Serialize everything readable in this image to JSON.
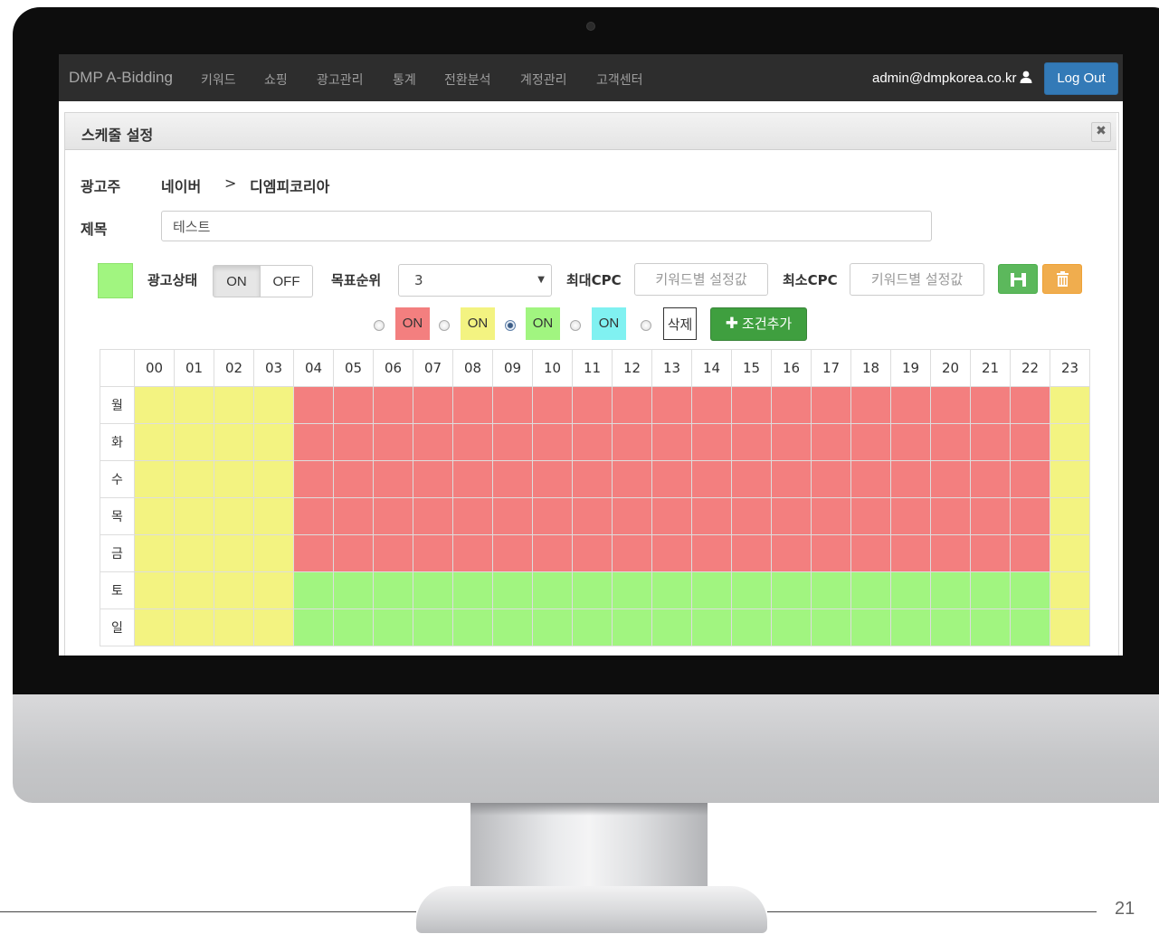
{
  "navbar": {
    "brand": "DMP A-Bidding",
    "items": [
      "키워드",
      "쇼핑",
      "광고관리",
      "통계",
      "전환분석",
      "계정관리",
      "고객센터"
    ],
    "user": "admin@dmpkorea.co.kr",
    "logout_label": "Log Out"
  },
  "modal": {
    "title": "스케줄 설정",
    "close_icon": "close-icon"
  },
  "advertiser": {
    "label": "광고주",
    "platform": "네이버",
    "separator": ">",
    "name": "디엠피코리아"
  },
  "subject": {
    "label": "제목",
    "value": "테스트"
  },
  "controls": {
    "current_color": "#a1f580",
    "status_label": "광고상태",
    "on_label": "ON",
    "off_label": "OFF",
    "status_value": "ON",
    "target_rank_label": "목표순위",
    "target_rank_value": "3",
    "max_cpc_label": "최대CPC",
    "max_cpc_placeholder": "키워드별 설정값",
    "min_cpc_label": "최소CPC",
    "min_cpc_placeholder": "키워드별 설정값",
    "save_icon": "save-icon",
    "delete_icon": "trash-icon"
  },
  "conditions": {
    "items": [
      {
        "label": "ON",
        "color": "#f37f7f",
        "selected": false
      },
      {
        "label": "ON",
        "color": "#f3f381",
        "selected": false
      },
      {
        "label": "ON",
        "color": "#a1f580",
        "selected": true
      },
      {
        "label": "ON",
        "color": "#80f1f1",
        "selected": false
      },
      {
        "label": "삭제",
        "color": "#ffffff",
        "selected": false
      }
    ],
    "add_label": "조건추가"
  },
  "schedule": {
    "hours": [
      "00",
      "01",
      "02",
      "03",
      "04",
      "05",
      "06",
      "07",
      "08",
      "09",
      "10",
      "11",
      "12",
      "13",
      "14",
      "15",
      "16",
      "17",
      "18",
      "19",
      "20",
      "21",
      "22",
      "23"
    ],
    "days": [
      "월",
      "화",
      "수",
      "목",
      "금",
      "토",
      "일"
    ],
    "legend": {
      "1": "red",
      "2": "yellow",
      "3": "green",
      "4": "cyan"
    },
    "grid": [
      [
        2,
        2,
        2,
        2,
        1,
        1,
        1,
        1,
        1,
        1,
        1,
        1,
        1,
        1,
        1,
        1,
        1,
        1,
        1,
        1,
        1,
        1,
        1,
        2
      ],
      [
        2,
        2,
        2,
        2,
        1,
        1,
        1,
        1,
        1,
        1,
        1,
        1,
        1,
        1,
        1,
        1,
        1,
        1,
        1,
        1,
        1,
        1,
        1,
        2
      ],
      [
        2,
        2,
        2,
        2,
        1,
        1,
        1,
        1,
        1,
        1,
        1,
        1,
        1,
        1,
        1,
        1,
        1,
        1,
        1,
        1,
        1,
        1,
        1,
        2
      ],
      [
        2,
        2,
        2,
        2,
        1,
        1,
        1,
        1,
        1,
        1,
        1,
        1,
        1,
        1,
        1,
        1,
        1,
        1,
        1,
        1,
        1,
        1,
        1,
        2
      ],
      [
        2,
        2,
        2,
        2,
        1,
        1,
        1,
        1,
        1,
        1,
        1,
        1,
        1,
        1,
        1,
        1,
        1,
        1,
        1,
        1,
        1,
        1,
        1,
        2
      ],
      [
        2,
        2,
        2,
        2,
        3,
        3,
        3,
        3,
        3,
        3,
        3,
        3,
        3,
        3,
        3,
        3,
        3,
        3,
        3,
        3,
        3,
        3,
        3,
        2
      ],
      [
        2,
        2,
        2,
        2,
        3,
        3,
        3,
        3,
        3,
        3,
        3,
        3,
        3,
        3,
        3,
        3,
        3,
        3,
        3,
        3,
        3,
        3,
        3,
        2
      ]
    ]
  },
  "page_number": "21"
}
